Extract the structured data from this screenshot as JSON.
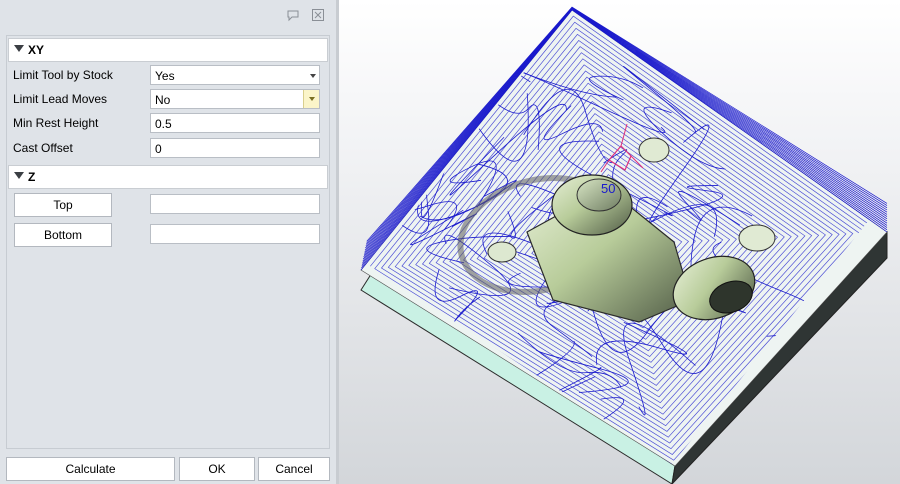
{
  "titlebar": {
    "comment_icon": "comment-icon",
    "close_icon": "close-icon"
  },
  "sections": {
    "xy": {
      "title": "XY"
    },
    "z": {
      "title": "Z"
    }
  },
  "fields": {
    "limit_tool_by_stock": {
      "label": "Limit Tool by Stock",
      "value": "Yes"
    },
    "limit_lead_moves": {
      "label": "Limit Lead Moves",
      "value": "No"
    },
    "min_rest_height": {
      "label": "Min Rest Height",
      "value": "0.5"
    },
    "cast_offset": {
      "label": "Cast Offset",
      "value": "0"
    }
  },
  "z": {
    "top_label": "Top",
    "top_value": "",
    "bottom_label": "Bottom",
    "bottom_value": ""
  },
  "footer": {
    "calculate": "Calculate",
    "ok": "OK",
    "cancel": "Cancel"
  },
  "viewport": {
    "tool_label": "50"
  },
  "colors": {
    "toolpath": "#1a1acc",
    "stock_side": "#c9f1e4",
    "part": "#c4d6a8",
    "highlight": "#e0307a"
  }
}
